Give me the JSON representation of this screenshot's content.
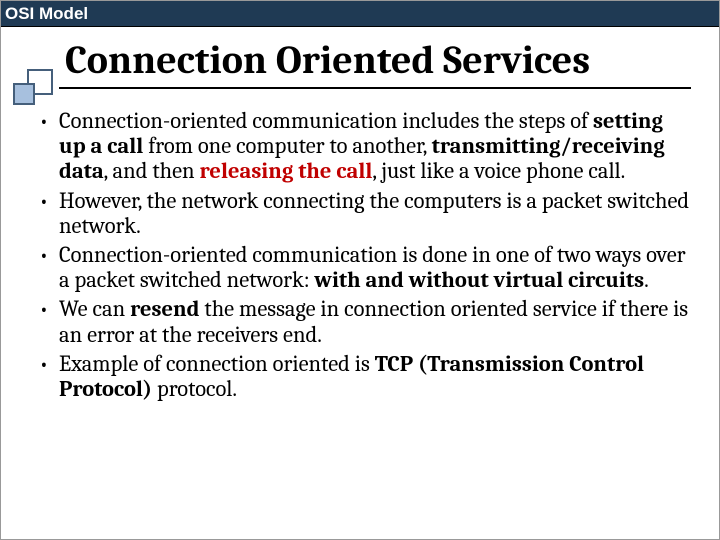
{
  "header": {
    "title": "OSI Model"
  },
  "title": "Connection Oriented Services",
  "bullets": {
    "b1": {
      "t1": "Connection-oriented communication includes the steps of ",
      "s1": "setting up a call",
      "t2": " from one computer to another, ",
      "s2": "transmitting/receiving data",
      "t3": ", and then ",
      "s3": "releasing the call",
      "t4": ", just like a voice phone call."
    },
    "b2": "However, the network connecting the computers is a packet switched network.",
    "b3": {
      "t1": "Connection-oriented communication is done in one of two ways over a packet switched network: ",
      "s1": "with and without virtual circuits",
      "t2": "."
    },
    "b4": {
      "t1": "We can ",
      "s1": "resend",
      "t2": " the message in connection oriented service if there is an error at the receivers end."
    },
    "b5": {
      "t1": "Example of connection oriented is ",
      "s1": "TCP (Transmission Control Protocol)",
      "t2": " protocol."
    }
  }
}
